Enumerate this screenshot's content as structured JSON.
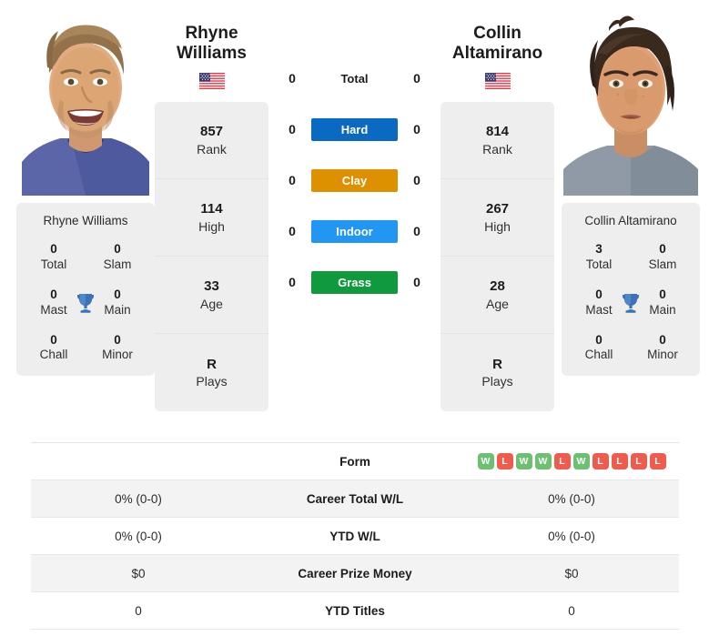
{
  "players": {
    "left": {
      "first_name": "Rhyne",
      "last_name": "Williams",
      "full_name": "Rhyne Williams",
      "country": "USA",
      "flag_icon": "us-flag-icon",
      "photo_alt": "Rhyne Williams headshot",
      "rank": "857",
      "rank_label": "Rank",
      "high": "114",
      "high_label": "High",
      "age": "33",
      "age_label": "Age",
      "plays": "R",
      "plays_label": "Plays",
      "titles": {
        "total": "0",
        "total_label": "Total",
        "slam": "0",
        "slam_label": "Slam",
        "mast": "0",
        "mast_label": "Mast",
        "main": "0",
        "main_label": "Main",
        "chall": "0",
        "chall_label": "Chall",
        "minor": "0",
        "minor_label": "Minor"
      }
    },
    "right": {
      "first_name": "Collin",
      "last_name": "Altamirano",
      "full_name": "Collin Altamirano",
      "country": "USA",
      "flag_icon": "us-flag-icon",
      "photo_alt": "Collin Altamirano headshot",
      "rank": "814",
      "rank_label": "Rank",
      "high": "267",
      "high_label": "High",
      "age": "28",
      "age_label": "Age",
      "plays": "R",
      "plays_label": "Plays",
      "titles": {
        "total": "3",
        "total_label": "Total",
        "slam": "0",
        "slam_label": "Slam",
        "mast": "0",
        "mast_label": "Mast",
        "main": "0",
        "main_label": "Main",
        "chall": "0",
        "chall_label": "Chall",
        "minor": "0",
        "minor_label": "Minor"
      }
    }
  },
  "head_to_head": [
    {
      "label": "Total",
      "left": "0",
      "right": "0",
      "style": "plain",
      "color": ""
    },
    {
      "label": "Hard",
      "left": "0",
      "right": "0",
      "style": "surface",
      "color": "#0a69c0"
    },
    {
      "label": "Clay",
      "left": "0",
      "right": "0",
      "style": "surface",
      "color": "#dd9000"
    },
    {
      "label": "Indoor",
      "left": "0",
      "right": "0",
      "style": "surface",
      "color": "#2196f3"
    },
    {
      "label": "Grass",
      "left": "0",
      "right": "0",
      "style": "surface",
      "color": "#119a3d"
    }
  ],
  "stats_table": {
    "rows": [
      {
        "label": "Form",
        "left": "",
        "right": "",
        "type": "form"
      },
      {
        "label": "Career Total W/L",
        "left": "0% (0-0)",
        "right": "0% (0-0)",
        "type": "text"
      },
      {
        "label": "YTD W/L",
        "left": "0% (0-0)",
        "right": "0% (0-0)",
        "type": "text"
      },
      {
        "label": "Career Prize Money",
        "left": "$0",
        "right": "$0",
        "type": "text"
      },
      {
        "label": "YTD Titles",
        "left": "0",
        "right": "0",
        "type": "text"
      }
    ],
    "form_right": [
      "W",
      "L",
      "W",
      "W",
      "L",
      "W",
      "L",
      "L",
      "L",
      "L"
    ],
    "form_left": []
  },
  "colors": {
    "win": "#6cc070",
    "loss": "#ef5b4c",
    "card_bg": "#eeeeef",
    "row_alt": "#f3f3f4",
    "trophy": "#3e72b8"
  }
}
